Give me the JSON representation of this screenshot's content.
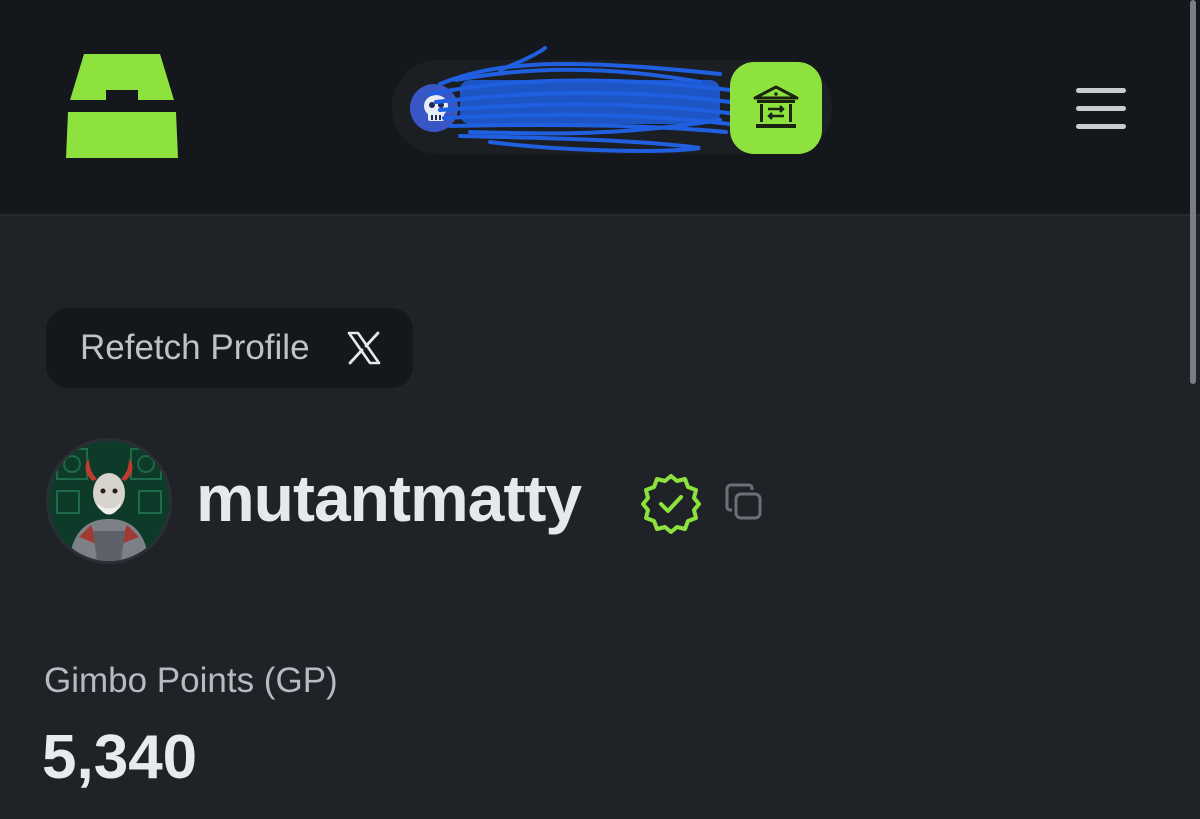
{
  "header": {
    "logo_icon": "app-logo-icon",
    "wallet": {
      "avatar_icon": "skull-avatar-icon",
      "address": ""
    },
    "bank_button_icon": "bank-transfer-icon",
    "menu_icon": "hamburger-menu-icon",
    "accent_color": "#8ee23d"
  },
  "profile": {
    "refetch_label": "Refetch Profile",
    "refetch_icon": "x-logo-icon",
    "username": "mutantmatty",
    "verified_icon": "verified-badge-icon",
    "copy_icon": "copy-icon",
    "points_label": "Gimbo Points (GP)",
    "points_value": "5,340"
  },
  "colors": {
    "background": "#1f2328",
    "header_background": "#14171b",
    "accent": "#8ee23d",
    "text_primary": "#e6e8eb",
    "text_secondary": "#b6bbc1"
  }
}
